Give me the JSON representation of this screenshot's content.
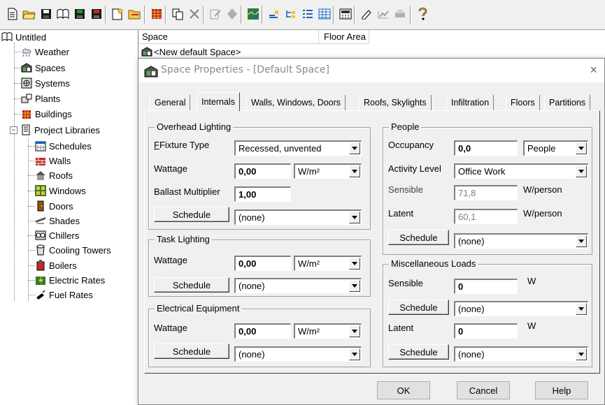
{
  "tree": {
    "root": "Untitled",
    "items": [
      {
        "label": "Weather",
        "icon": "weather-icon"
      },
      {
        "label": "Spaces",
        "icon": "space-icon"
      },
      {
        "label": "Systems",
        "icon": "system-icon"
      },
      {
        "label": "Plants",
        "icon": "plant-icon"
      },
      {
        "label": "Buildings",
        "icon": "building-icon"
      },
      {
        "label": "Project Libraries",
        "icon": "library-icon"
      },
      {
        "label": "Schedules",
        "icon": "schedule-icon"
      },
      {
        "label": "Walls",
        "icon": "wall-icon"
      },
      {
        "label": "Roofs",
        "icon": "roof-icon"
      },
      {
        "label": "Windows",
        "icon": "window-icon"
      },
      {
        "label": "Doors",
        "icon": "door-icon"
      },
      {
        "label": "Shades",
        "icon": "shade-icon"
      },
      {
        "label": "Chillers",
        "icon": "chiller-icon"
      },
      {
        "label": "Cooling Towers",
        "icon": "cooling-tower-icon"
      },
      {
        "label": "Boilers",
        "icon": "boiler-icon"
      },
      {
        "label": "Electric Rates",
        "icon": "electric-rate-icon"
      },
      {
        "label": "Fuel Rates",
        "icon": "fuel-rate-icon"
      }
    ]
  },
  "list": {
    "col_space": "Space",
    "col_floor_area": "Floor Area",
    "row0": "<New default Space>"
  },
  "dialog": {
    "title": "Space Properties - [Default Space]",
    "close": "×",
    "tabs": [
      "General",
      "Internals",
      "Walls, Windows, Doors",
      "Roofs, Skylights",
      "Infiltration",
      "Floors",
      "Partitions"
    ],
    "active_tab": "Internals",
    "overhead": {
      "title": "Overhead Lighting",
      "fixture_label": "Fixture Type",
      "fixture_value": "Recessed, unvented",
      "wattage_label": "Wattage",
      "wattage_value": "0,00",
      "wattage_unit": "W/m²",
      "ballast_label": "Ballast Multiplier",
      "ballast_value": "1,00",
      "schedule_btn": "Schedule",
      "schedule_value": "(none)"
    },
    "task": {
      "title": "Task Lighting",
      "wattage_label": "Wattage",
      "wattage_value": "0,00",
      "wattage_unit": "W/m²",
      "schedule_btn": "Schedule",
      "schedule_value": "(none)"
    },
    "electrical": {
      "title": "Electrical Equipment",
      "wattage_label": "Wattage",
      "wattage_value": "0,00",
      "wattage_unit": "W/m²",
      "schedule_btn": "Schedule",
      "schedule_value": "(none)"
    },
    "people": {
      "title": "People",
      "occupancy_label": "Occupancy",
      "occupancy_value": "0,0",
      "occupancy_unit": "People",
      "activity_label": "Activity Level",
      "activity_value": "Office Work",
      "sensible_label": "Sensible",
      "sensible_value": "71,8",
      "sensible_unit": "W/person",
      "latent_label": "Latent",
      "latent_value": "60,1",
      "latent_unit": "W/person",
      "schedule_btn": "Schedule",
      "schedule_value": "(none)"
    },
    "misc": {
      "title": "Miscellaneous Loads",
      "sensible_label": "Sensible",
      "sensible_value": "0",
      "sensible_unit": "W",
      "schedule1_btn": "Schedule",
      "schedule1_value": "(none)",
      "latent_label": "Latent",
      "latent_value": "0",
      "latent_unit": "W",
      "schedule2_btn": "Schedule",
      "schedule2_value": "(none)"
    },
    "ok": "OK",
    "cancel": "Cancel",
    "help": "Help"
  }
}
